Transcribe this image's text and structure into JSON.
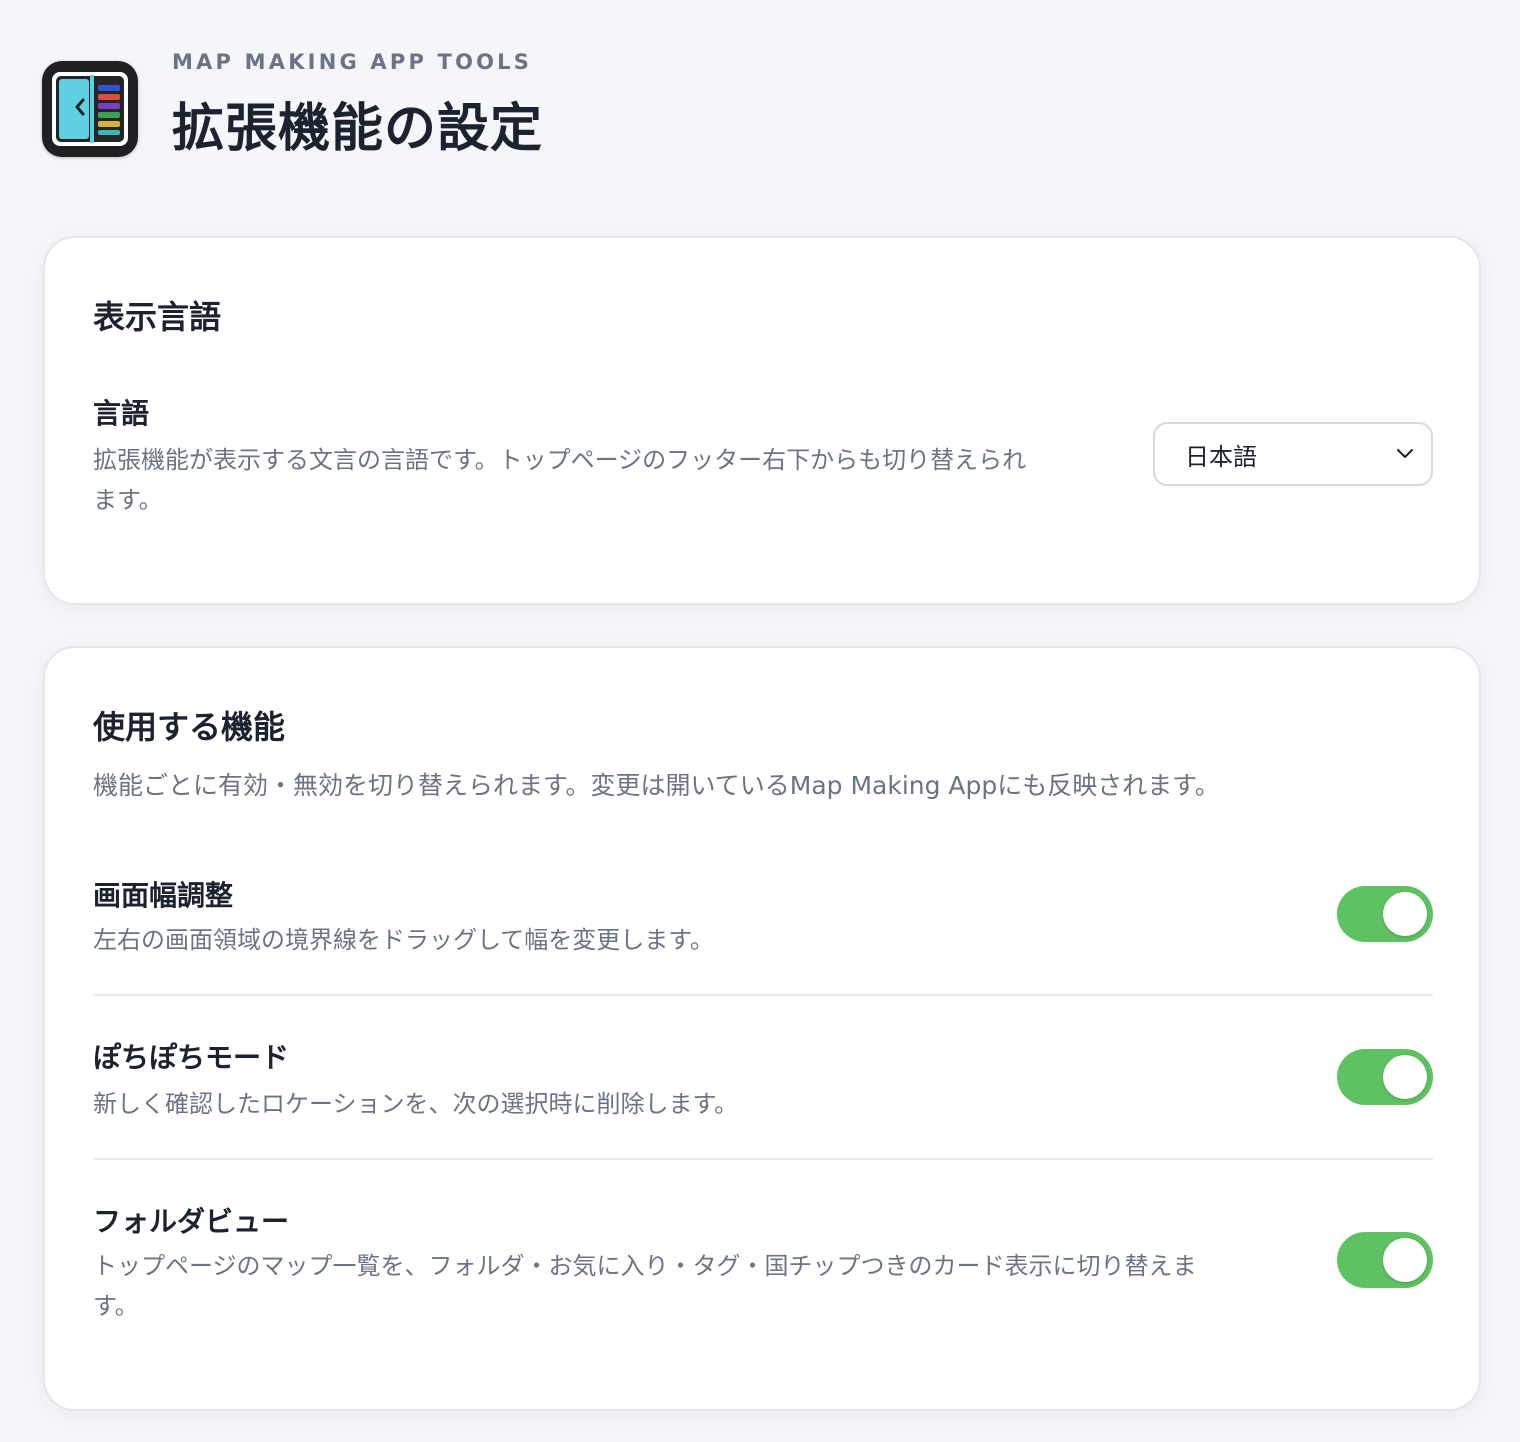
{
  "header": {
    "kicker": "MAP MAKING APP TOOLS",
    "title": "拡張機能の設定",
    "logo_icon": "map-making-app-logo-icon"
  },
  "language_section": {
    "title": "表示言語",
    "row": {
      "title": "言語",
      "description": "拡張機能が表示する文言の言語です。トップページのフッター右下からも切り替えられます。",
      "description_line1": "拡張機能が表示する文言の言語です。トップページのフッター右下からも切り替えられ",
      "description_line2": "ます。",
      "selected_value": "日本語",
      "options": [
        "日本語"
      ]
    }
  },
  "features_section": {
    "title": "使用する機能",
    "description": "機能ごとに有効・無効を切り替えられます。変更は開いているMap Making Appにも反映されます。",
    "items": [
      {
        "title": "画面幅調整",
        "description_line1": "左右の画面領域の境界線をドラッグして幅を変更します。",
        "description_line2": "",
        "enabled": true
      },
      {
        "title": "ぽちぽちモード",
        "description_line1": "新しく確認したロケーションを、次の選択時に削除します。",
        "description_line2": "",
        "enabled": true
      },
      {
        "title": "フォルダビュー",
        "description_line1": "トップページのマップ一覧を、フォルダ・お気に入り・タグ・国チップつきのカード表示に切り替えま",
        "description_line2": "す。",
        "enabled": true
      }
    ]
  },
  "colors": {
    "background": "#f5f6f9",
    "card": "#ffffff",
    "text_primary": "#1c2330",
    "text_muted": "#6b7486",
    "toggle_on": "#5fc262",
    "logo_panel": "#5fd0e3"
  }
}
